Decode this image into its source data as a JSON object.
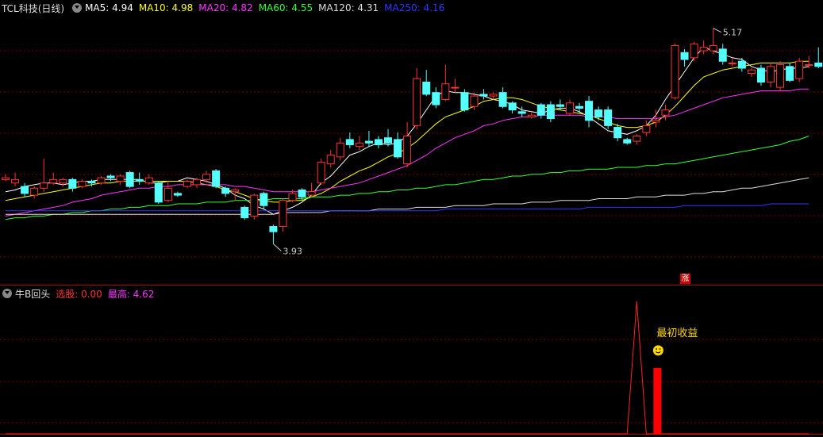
{
  "stock": {
    "title": "TCL科技(日线)"
  },
  "ma_legend": [
    {
      "label": "MA5: 4.94",
      "color": "#ffffff"
    },
    {
      "label": "MA10: 4.98",
      "color": "#ffff00"
    },
    {
      "label": "MA20: 4.82",
      "color": "#ff33ff"
    },
    {
      "label": "MA60: 4.55",
      "color": "#33ff33"
    },
    {
      "label": "MA120: 4.31",
      "color": "#dddddd"
    },
    {
      "label": "MA250: 4.16",
      "color": "#3333ff"
    }
  ],
  "indicator": {
    "name": "牛B回头",
    "select_label": "选股: 0.00",
    "select_color": "#ff3333",
    "high_label": "最高: 4.62",
    "high_color": "#ff33ff",
    "annotation": "最初收益",
    "smile_icon": "smiley-icon",
    "zhang_tag": "涨"
  },
  "colors": {
    "up": "#ff3232",
    "down": "#54ffff",
    "grid": "#7a0000"
  },
  "chart_data": [
    {
      "type": "candlestick",
      "title": "TCL科技(日线)",
      "ylim": [
        3.8,
        5.25
      ],
      "annotations": [
        {
          "label": "5.17",
          "value": 5.17,
          "kind": "max"
        },
        {
          "label": "3.93",
          "value": 3.93,
          "kind": "min"
        }
      ],
      "candles": [
        [
          4.3,
          4.31,
          4.29,
          4.33
        ],
        [
          4.28,
          4.3,
          4.26,
          4.34
        ],
        [
          4.26,
          4.22,
          4.2,
          4.28
        ],
        [
          4.21,
          4.25,
          4.19,
          4.26
        ],
        [
          4.25,
          4.28,
          4.23,
          4.42
        ],
        [
          4.28,
          4.3,
          4.27,
          4.34
        ],
        [
          4.28,
          4.3,
          4.26,
          4.31
        ],
        [
          4.3,
          4.25,
          4.23,
          4.31
        ],
        [
          4.26,
          4.29,
          4.25,
          4.3
        ],
        [
          4.29,
          4.28,
          4.26,
          4.3
        ],
        [
          4.28,
          4.31,
          4.27,
          4.32
        ],
        [
          4.32,
          4.31,
          4.29,
          4.33
        ],
        [
          4.29,
          4.32,
          4.27,
          4.33
        ],
        [
          4.34,
          4.26,
          4.25,
          4.35
        ],
        [
          4.3,
          4.29,
          4.27,
          4.34
        ],
        [
          4.28,
          4.31,
          4.27,
          4.33
        ],
        [
          4.28,
          4.17,
          4.16,
          4.29
        ],
        [
          4.18,
          4.25,
          4.17,
          4.29
        ],
        [
          4.22,
          4.21,
          4.2,
          4.23
        ],
        [
          4.26,
          4.29,
          4.25,
          4.3
        ],
        [
          4.27,
          4.3,
          4.25,
          4.31
        ],
        [
          4.3,
          4.33,
          4.28,
          4.35
        ],
        [
          4.35,
          4.26,
          4.25,
          4.36
        ],
        [
          4.25,
          4.22,
          4.2,
          4.26
        ],
        [
          4.23,
          4.24,
          4.18,
          4.25
        ],
        [
          4.14,
          4.08,
          4.07,
          4.15
        ],
        [
          4.09,
          4.21,
          4.07,
          4.22
        ],
        [
          4.22,
          4.15,
          4.13,
          4.23
        ],
        [
          4.03,
          4.0,
          3.93,
          4.04
        ],
        [
          4.03,
          4.18,
          4.0,
          4.19
        ],
        [
          4.18,
          4.22,
          4.17,
          4.24
        ],
        [
          4.24,
          4.2,
          4.18,
          4.25
        ],
        [
          4.21,
          4.23,
          4.2,
          4.28
        ],
        [
          4.28,
          4.4,
          4.27,
          4.42
        ],
        [
          4.39,
          4.44,
          4.37,
          4.47
        ],
        [
          4.43,
          4.51,
          4.41,
          4.54
        ],
        [
          4.53,
          4.5,
          4.48,
          4.57
        ],
        [
          4.49,
          4.51,
          4.47,
          4.55
        ],
        [
          4.52,
          4.51,
          4.49,
          4.58
        ],
        [
          4.53,
          4.5,
          4.48,
          4.55
        ],
        [
          4.54,
          4.51,
          4.49,
          4.59
        ],
        [
          4.53,
          4.43,
          4.42,
          4.57
        ],
        [
          4.39,
          4.55,
          4.37,
          4.63
        ],
        [
          4.61,
          4.88,
          4.59,
          4.94
        ],
        [
          4.86,
          4.79,
          4.78,
          4.93
        ],
        [
          4.8,
          4.73,
          4.71,
          4.83
        ],
        [
          4.76,
          4.85,
          4.75,
          4.96
        ],
        [
          4.83,
          4.83,
          4.8,
          4.88
        ],
        [
          4.8,
          4.7,
          4.69,
          4.82
        ],
        [
          4.72,
          4.78,
          4.7,
          4.8
        ],
        [
          4.79,
          4.78,
          4.76,
          4.82
        ],
        [
          4.78,
          4.79,
          4.76,
          4.8
        ],
        [
          4.8,
          4.72,
          4.71,
          4.83
        ],
        [
          4.74,
          4.7,
          4.68,
          4.75
        ],
        [
          4.69,
          4.68,
          4.66,
          4.72
        ],
        [
          4.66,
          4.67,
          4.65,
          4.69
        ],
        [
          4.73,
          4.67,
          4.65,
          4.74
        ],
        [
          4.73,
          4.65,
          4.63,
          4.75
        ],
        [
          4.73,
          4.72,
          4.7,
          4.76
        ],
        [
          4.68,
          4.74,
          4.67,
          4.76
        ],
        [
          4.72,
          4.71,
          4.68,
          4.74
        ],
        [
          4.75,
          4.64,
          4.6,
          4.78
        ],
        [
          4.7,
          4.66,
          4.64,
          4.72
        ],
        [
          4.7,
          4.61,
          4.59,
          4.72
        ],
        [
          4.6,
          4.54,
          4.52,
          4.62
        ],
        [
          4.53,
          4.51,
          4.5,
          4.54
        ],
        [
          4.52,
          4.55,
          4.5,
          4.56
        ],
        [
          4.57,
          4.61,
          4.55,
          4.64
        ],
        [
          4.63,
          4.64,
          4.6,
          4.7
        ],
        [
          4.67,
          4.7,
          4.64,
          4.73
        ],
        [
          4.77,
          5.07,
          4.76,
          5.08
        ],
        [
          5.03,
          4.99,
          4.95,
          5.05
        ],
        [
          5.0,
          5.08,
          4.98,
          5.09
        ],
        [
          5.04,
          5.06,
          5.02,
          5.1
        ],
        [
          5.04,
          5.07,
          5.02,
          5.17
        ],
        [
          5.05,
          4.98,
          4.96,
          5.08
        ],
        [
          4.97,
          4.97,
          4.95,
          5.0
        ],
        [
          4.98,
          4.94,
          4.92,
          5.0
        ],
        [
          4.91,
          4.93,
          4.89,
          4.94
        ],
        [
          4.94,
          4.86,
          4.84,
          4.96
        ],
        [
          4.86,
          4.95,
          4.83,
          4.97
        ],
        [
          4.83,
          4.96,
          4.81,
          4.98
        ],
        [
          4.95,
          4.87,
          4.86,
          4.97
        ],
        [
          4.88,
          4.98,
          4.86,
          5.0
        ],
        [
          4.96,
          4.96,
          4.94,
          5.01
        ],
        [
          4.97,
          4.95,
          4.94,
          5.06
        ]
      ],
      "ma_series": [
        {
          "name": "MA5",
          "color": "#ffffff",
          "values": [
            4.23,
            4.24,
            4.26,
            4.27,
            4.28,
            4.28,
            4.27,
            4.28,
            4.29,
            4.29,
            4.3,
            4.3,
            4.3,
            4.3,
            4.3,
            4.28,
            4.28,
            4.29,
            4.29,
            4.31,
            4.3,
            4.29,
            4.27,
            4.25,
            4.21,
            4.19,
            4.15,
            4.13,
            4.1,
            4.12,
            4.14,
            4.17,
            4.21,
            4.28,
            4.32,
            4.38,
            4.44,
            4.46,
            4.49,
            4.51,
            4.5,
            4.51,
            4.55,
            4.62,
            4.7,
            4.78,
            4.81,
            4.8,
            4.8,
            4.79,
            4.78,
            4.76,
            4.75,
            4.73,
            4.7,
            4.69,
            4.68,
            4.7,
            4.71,
            4.71,
            4.69,
            4.66,
            4.62,
            4.58,
            4.57,
            4.56,
            4.58,
            4.61,
            4.67,
            4.76,
            4.84,
            4.92,
            5.0,
            5.06,
            5.04,
            5.02,
            5.0,
            4.99,
            4.95,
            4.93,
            4.92,
            4.93,
            4.94,
            4.94,
            4.95
          ]
        },
        {
          "name": "MA10",
          "color": "#ffff00",
          "values": [
            4.18,
            4.19,
            4.2,
            4.21,
            4.22,
            4.23,
            4.24,
            4.25,
            4.26,
            4.27,
            4.28,
            4.28,
            4.29,
            4.29,
            4.29,
            4.29,
            4.29,
            4.29,
            4.29,
            4.29,
            4.28,
            4.27,
            4.26,
            4.24,
            4.23,
            4.21,
            4.19,
            4.18,
            4.17,
            4.17,
            4.18,
            4.18,
            4.2,
            4.22,
            4.25,
            4.29,
            4.32,
            4.35,
            4.37,
            4.4,
            4.43,
            4.45,
            4.48,
            4.52,
            4.57,
            4.62,
            4.66,
            4.68,
            4.7,
            4.72,
            4.75,
            4.76,
            4.77,
            4.77,
            4.76,
            4.74,
            4.72,
            4.71,
            4.7,
            4.69,
            4.68,
            4.67,
            4.65,
            4.63,
            4.61,
            4.6,
            4.6,
            4.61,
            4.63,
            4.67,
            4.72,
            4.78,
            4.84,
            4.89,
            4.91,
            4.93,
            4.94,
            4.95,
            4.96,
            4.97,
            4.97,
            4.97,
            4.97,
            4.98,
            4.98
          ]
        },
        {
          "name": "MA20",
          "color": "#ff33ff",
          "values": [
            4.09,
            4.1,
            4.11,
            4.12,
            4.13,
            4.14,
            4.15,
            4.17,
            4.18,
            4.19,
            4.21,
            4.22,
            4.23,
            4.24,
            4.25,
            4.25,
            4.26,
            4.26,
            4.27,
            4.27,
            4.27,
            4.27,
            4.27,
            4.27,
            4.26,
            4.26,
            4.25,
            4.24,
            4.23,
            4.23,
            4.23,
            4.23,
            4.23,
            4.24,
            4.25,
            4.26,
            4.27,
            4.28,
            4.3,
            4.32,
            4.34,
            4.36,
            4.38,
            4.41,
            4.44,
            4.48,
            4.51,
            4.54,
            4.56,
            4.58,
            4.61,
            4.62,
            4.64,
            4.65,
            4.66,
            4.66,
            4.67,
            4.67,
            4.67,
            4.67,
            4.67,
            4.66,
            4.66,
            4.66,
            4.65,
            4.65,
            4.65,
            4.65,
            4.65,
            4.66,
            4.67,
            4.69,
            4.71,
            4.73,
            4.75,
            4.77,
            4.78,
            4.79,
            4.8,
            4.81,
            4.81,
            4.81,
            4.81,
            4.82,
            4.82
          ]
        },
        {
          "name": "MA60",
          "color": "#33ff33",
          "values": [
            4.07,
            4.08,
            4.08,
            4.09,
            4.09,
            4.1,
            4.1,
            4.11,
            4.11,
            4.12,
            4.12,
            4.13,
            4.13,
            4.14,
            4.14,
            4.15,
            4.15,
            4.15,
            4.16,
            4.16,
            4.16,
            4.17,
            4.17,
            4.17,
            4.18,
            4.18,
            4.18,
            4.18,
            4.19,
            4.19,
            4.19,
            4.19,
            4.2,
            4.2,
            4.2,
            4.21,
            4.21,
            4.22,
            4.22,
            4.23,
            4.23,
            4.24,
            4.24,
            4.25,
            4.25,
            4.26,
            4.27,
            4.27,
            4.28,
            4.29,
            4.3,
            4.3,
            4.31,
            4.32,
            4.32,
            4.33,
            4.33,
            4.34,
            4.34,
            4.35,
            4.35,
            4.36,
            4.36,
            4.36,
            4.37,
            4.37,
            4.37,
            4.38,
            4.38,
            4.39,
            4.39,
            4.4,
            4.41,
            4.42,
            4.43,
            4.44,
            4.45,
            4.46,
            4.47,
            4.48,
            4.49,
            4.5,
            4.52,
            4.53,
            4.55
          ]
        },
        {
          "name": "MA120",
          "color": "#dddddd",
          "values": [
            4.1,
            4.1,
            4.1,
            4.1,
            4.1,
            4.1,
            4.1,
            4.1,
            4.1,
            4.1,
            4.1,
            4.1,
            4.1,
            4.1,
            4.1,
            4.1,
            4.1,
            4.1,
            4.1,
            4.1,
            4.1,
            4.1,
            4.1,
            4.1,
            4.1,
            4.1,
            4.1,
            4.1,
            4.1,
            4.11,
            4.11,
            4.11,
            4.11,
            4.11,
            4.12,
            4.12,
            4.12,
            4.12,
            4.12,
            4.13,
            4.13,
            4.13,
            4.13,
            4.14,
            4.14,
            4.14,
            4.14,
            4.15,
            4.15,
            4.15,
            4.15,
            4.16,
            4.16,
            4.16,
            4.16,
            4.17,
            4.17,
            4.17,
            4.18,
            4.18,
            4.18,
            4.18,
            4.19,
            4.19,
            4.19,
            4.19,
            4.2,
            4.2,
            4.2,
            4.21,
            4.21,
            4.21,
            4.22,
            4.22,
            4.23,
            4.23,
            4.24,
            4.25,
            4.25,
            4.26,
            4.27,
            4.28,
            4.29,
            4.3,
            4.31
          ]
        },
        {
          "name": "MA250",
          "color": "#3333ff",
          "values": [
            4.12,
            4.12,
            4.12,
            4.12,
            4.12,
            4.12,
            4.12,
            4.12,
            4.12,
            4.12,
            4.12,
            4.12,
            4.12,
            4.12,
            4.12,
            4.12,
            4.12,
            4.12,
            4.12,
            4.12,
            4.12,
            4.12,
            4.12,
            4.12,
            4.12,
            4.12,
            4.12,
            4.12,
            4.12,
            4.12,
            4.12,
            4.12,
            4.12,
            4.12,
            4.12,
            4.12,
            4.12,
            4.12,
            4.12,
            4.12,
            4.12,
            4.12,
            4.12,
            4.12,
            4.12,
            4.12,
            4.13,
            4.13,
            4.13,
            4.13,
            4.13,
            4.13,
            4.13,
            4.13,
            4.13,
            4.13,
            4.13,
            4.13,
            4.13,
            4.13,
            4.13,
            4.14,
            4.14,
            4.14,
            4.14,
            4.14,
            4.14,
            4.14,
            4.14,
            4.14,
            4.14,
            4.15,
            4.15,
            4.15,
            4.15,
            4.15,
            4.15,
            4.15,
            4.15,
            4.15,
            4.16,
            4.16,
            4.16,
            4.16,
            4.16
          ]
        }
      ]
    },
    {
      "type": "line",
      "title": "牛B回头",
      "ylim": [
        0,
        4.62
      ],
      "signal_index": 67,
      "values": [
        0,
        0,
        0,
        0,
        0,
        0,
        0,
        0,
        0,
        0,
        0,
        0,
        0,
        0,
        0,
        0,
        0,
        0,
        0,
        0,
        0,
        0,
        0,
        0,
        0,
        0,
        0,
        0,
        0,
        0,
        0,
        0,
        0,
        0,
        0,
        0,
        0,
        0,
        0,
        0,
        0,
        0,
        0,
        0,
        0,
        0,
        0,
        0,
        0,
        0,
        0,
        0,
        0,
        0,
        0,
        0,
        0,
        0,
        0,
        0,
        0,
        0,
        0,
        0,
        0,
        0,
        4.62,
        0,
        0,
        0,
        0,
        0,
        0,
        0,
        0,
        0,
        0,
        0,
        0,
        0,
        0,
        0,
        0,
        0,
        0
      ],
      "bar_index": 67,
      "bar_value": 2.3
    }
  ]
}
